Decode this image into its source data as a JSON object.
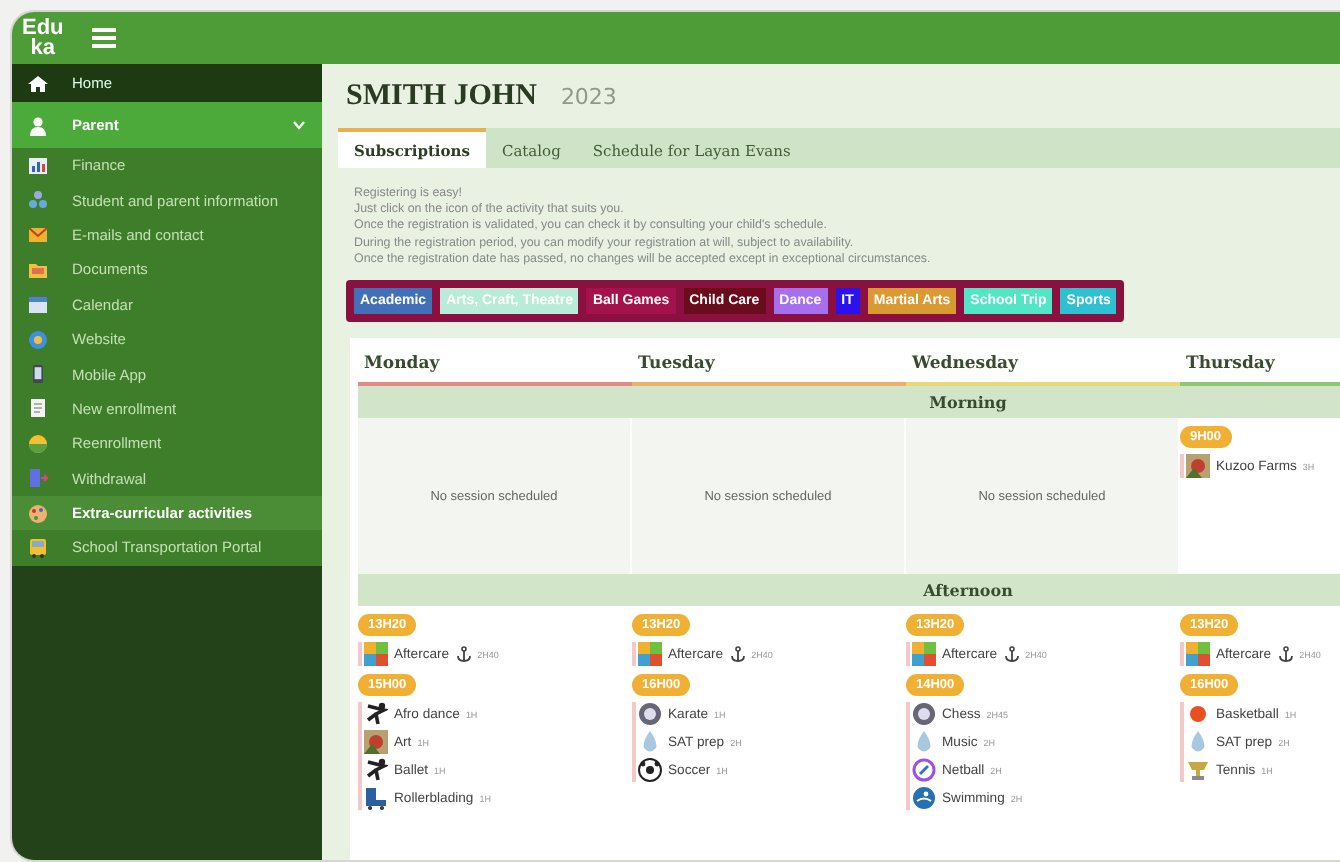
{
  "header": {
    "logo": [
      "Edu",
      "ka"
    ]
  },
  "sidebar": {
    "items": [
      {
        "kind": "home",
        "label": "Home",
        "selected": false
      },
      {
        "kind": "section",
        "label": "Parent",
        "expanded": true,
        "selected": false
      },
      {
        "kind": "item",
        "label": "Finance",
        "selected": false
      },
      {
        "kind": "item",
        "label": "Student and parent information",
        "selected": false
      },
      {
        "kind": "item",
        "label": "E-mails and contact",
        "selected": false
      },
      {
        "kind": "item",
        "label": "Documents",
        "selected": false
      },
      {
        "kind": "item",
        "label": "Calendar",
        "selected": false
      },
      {
        "kind": "item",
        "label": "Website",
        "selected": false
      },
      {
        "kind": "item",
        "label": "Mobile App",
        "selected": false
      },
      {
        "kind": "item",
        "label": "New enrollment",
        "selected": false
      },
      {
        "kind": "item",
        "label": "Reenrollment",
        "selected": false
      },
      {
        "kind": "item",
        "label": "Withdrawal",
        "selected": false
      },
      {
        "kind": "item",
        "label": "Extra-curricular activities",
        "selected": true
      },
      {
        "kind": "item",
        "label": "School Transportation Portal",
        "selected": false
      }
    ]
  },
  "title": {
    "name": "SMITH JOHN",
    "year": "2023"
  },
  "tabs": [
    {
      "label": "Subscriptions",
      "selected": true
    },
    {
      "label": "Catalog",
      "selected": false
    },
    {
      "label": "Schedule for Layan Evans",
      "selected": false
    }
  ],
  "instructions": [
    "Registering is easy!",
    "Just click on the icon of the activity that suits you.",
    "Once the registration is validated, you can check it by consulting your child's schedule.",
    "During the registration period, you can modify your registration at will, subject to availability.",
    "Once the registration date has passed, no changes will be accepted except in exceptional circumstances."
  ],
  "categories": [
    {
      "label": "Academic",
      "color": "#4270b8"
    },
    {
      "label": "Arts, Craft, Theatre",
      "color": "#b8ecd8"
    },
    {
      "label": "Ball Games",
      "color": "#a3124c"
    },
    {
      "label": "Child Care",
      "color": "#6a0c1c"
    },
    {
      "label": "Dance",
      "color": "#a56ff0"
    },
    {
      "label": "IT",
      "color": "#2a12f0"
    },
    {
      "label": "Martial Arts",
      "color": "#d99a32"
    },
    {
      "label": "School Trip",
      "color": "#52e6c6"
    },
    {
      "label": "Sports",
      "color": "#2fc0d2"
    }
  ],
  "schedule": {
    "days": [
      {
        "name": "Monday",
        "color": "#e28a86"
      },
      {
        "name": "Tuesday",
        "color": "#eab070"
      },
      {
        "name": "Wednesday",
        "color": "#e8d878"
      },
      {
        "name": "Thursday",
        "color": "#8cc878"
      }
    ],
    "periods": [
      {
        "label": "Morning",
        "cells": [
          {
            "empty": "No session scheduled"
          },
          {
            "empty": "No session scheduled"
          },
          {
            "empty": "No session scheduled"
          },
          {
            "slots": [
              {
                "time": "9H00",
                "activities": [
                  {
                    "name": "Kuzoo Farms",
                    "duration": "3H"
                  }
                ]
              }
            ]
          }
        ]
      },
      {
        "label": "Afternoon",
        "cells": [
          {
            "slots": [
              {
                "time": "13H20",
                "activities": [
                  {
                    "name": "Aftercare",
                    "duration": "2H40",
                    "anchor": true
                  }
                ]
              },
              {
                "time": "15H00",
                "activities": [
                  {
                    "name": "Afro dance",
                    "duration": "1H"
                  },
                  {
                    "name": "Art",
                    "duration": "1H"
                  },
                  {
                    "name": "Ballet",
                    "duration": "1H"
                  },
                  {
                    "name": "Rollerblading",
                    "duration": "1H"
                  }
                ]
              }
            ]
          },
          {
            "slots": [
              {
                "time": "13H20",
                "activities": [
                  {
                    "name": "Aftercare",
                    "duration": "2H40",
                    "anchor": true
                  }
                ]
              },
              {
                "time": "16H00",
                "activities": [
                  {
                    "name": "Karate",
                    "duration": "1H"
                  },
                  {
                    "name": "SAT prep",
                    "duration": "2H"
                  },
                  {
                    "name": "Soccer",
                    "duration": "1H"
                  }
                ]
              }
            ]
          },
          {
            "slots": [
              {
                "time": "13H20",
                "activities": [
                  {
                    "name": "Aftercare",
                    "duration": "2H40",
                    "anchor": true
                  }
                ]
              },
              {
                "time": "14H00",
                "activities": [
                  {
                    "name": "Chess",
                    "duration": "2H45"
                  },
                  {
                    "name": "Music",
                    "duration": "2H"
                  },
                  {
                    "name": "Netball",
                    "duration": "2H"
                  },
                  {
                    "name": "Swimming",
                    "duration": "2H"
                  }
                ]
              }
            ]
          },
          {
            "slots": [
              {
                "time": "13H20",
                "activities": [
                  {
                    "name": "Aftercare",
                    "duration": "2H40",
                    "anchor": true
                  }
                ]
              },
              {
                "time": "16H00",
                "activities": [
                  {
                    "name": "Basketball",
                    "duration": "1H"
                  },
                  {
                    "name": "SAT prep",
                    "duration": "2H"
                  },
                  {
                    "name": "Tennis",
                    "duration": "1H"
                  }
                ]
              }
            ]
          }
        ]
      }
    ]
  }
}
